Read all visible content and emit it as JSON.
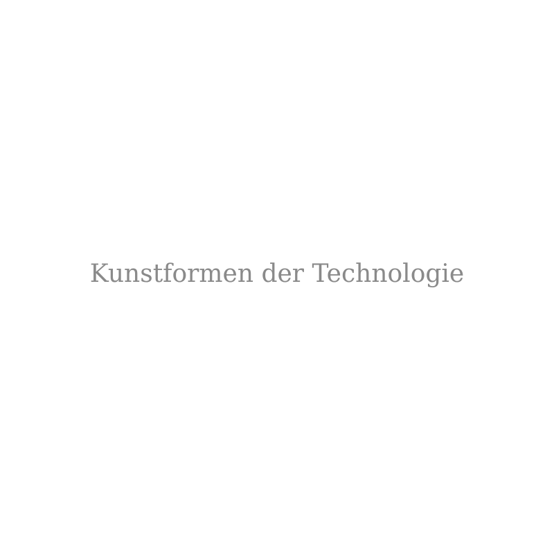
{
  "page": {
    "title": "Kunstformen der Technologie",
    "text_color": "#8a8a8a",
    "background_color": "#ffffff"
  }
}
